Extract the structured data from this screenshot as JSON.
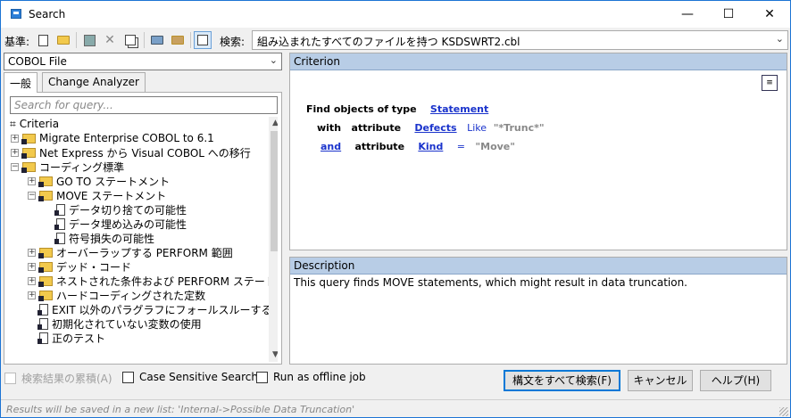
{
  "window": {
    "title": "Search",
    "min": "—",
    "max": "☐",
    "close": "✕"
  },
  "toolbar": {
    "base_label": "基準:",
    "search_label": "検索:",
    "search_value": "組み込まれたすべてのファイルを持つ KSDSWRT2.cbl",
    "arrow": "⌄"
  },
  "left": {
    "scope_value": "COBOL File",
    "tabs": [
      "一般",
      "Change Analyzer"
    ],
    "search_placeholder": "Search for query...",
    "tree": [
      {
        "label": "Criteria",
        "level": 0,
        "kind": "root"
      },
      {
        "label": "Migrate Enterprise COBOL to 6.1",
        "level": 1,
        "kind": "folder",
        "exp": "+"
      },
      {
        "label": "Net Express から Visual COBOL への移行",
        "level": 1,
        "kind": "folder",
        "exp": "+"
      },
      {
        "label": "コーディング標準",
        "level": 1,
        "kind": "folder",
        "exp": "−"
      },
      {
        "label": "GO TO ステートメント",
        "level": 2,
        "kind": "folder",
        "exp": "+"
      },
      {
        "label": "MOVE ステートメント",
        "level": 2,
        "kind": "folder",
        "exp": "−"
      },
      {
        "label": "データ切り捨ての可能性",
        "level": 3,
        "kind": "query"
      },
      {
        "label": "データ埋め込みの可能性",
        "level": 3,
        "kind": "query"
      },
      {
        "label": "符号損失の可能性",
        "level": 3,
        "kind": "query"
      },
      {
        "label": "オーバーラップする PERFORM 範囲",
        "level": 2,
        "kind": "folder",
        "exp": "+"
      },
      {
        "label": "デッド・コード",
        "level": 2,
        "kind": "folder",
        "exp": "+"
      },
      {
        "label": "ネストされた条件および PERFORM ステートメン",
        "level": 2,
        "kind": "folder",
        "exp": "+"
      },
      {
        "label": "ハードコーディングされた定数",
        "level": 2,
        "kind": "folder",
        "exp": "+"
      },
      {
        "label": "EXIT 以外のパラグラフにフォールスルーするパラ",
        "level": 2,
        "kind": "query"
      },
      {
        "label": "初期化されていない変数の使用",
        "level": 2,
        "kind": "query"
      },
      {
        "label": "正のテスト",
        "level": 2,
        "kind": "query"
      }
    ]
  },
  "criterion": {
    "header": "Criterion",
    "line1": {
      "text": "Find objects of type",
      "link": "Statement"
    },
    "line2": {
      "kw": "with",
      "attr": "attribute",
      "link": "Defects",
      "op": "Like",
      "val": "\"*Trunc*\""
    },
    "line3": {
      "kw": "and",
      "attr": "attribute",
      "link": "Kind",
      "op": "=",
      "val": "\"Move\""
    }
  },
  "description": {
    "header": "Description",
    "text": "This query finds MOVE statements, which might result in data truncation."
  },
  "bottom": {
    "accumulate_label": "検索結果の累積(A)",
    "case_label": "Case Sensitive Search",
    "offline_label": "Run as offline job",
    "search_all": "構文をすべて検索(F)",
    "cancel": "キャンセル",
    "help": "ヘルプ(H)"
  },
  "status": {
    "text": "Results will be saved in a new list: 'Internal->Possible Data Truncation'"
  }
}
